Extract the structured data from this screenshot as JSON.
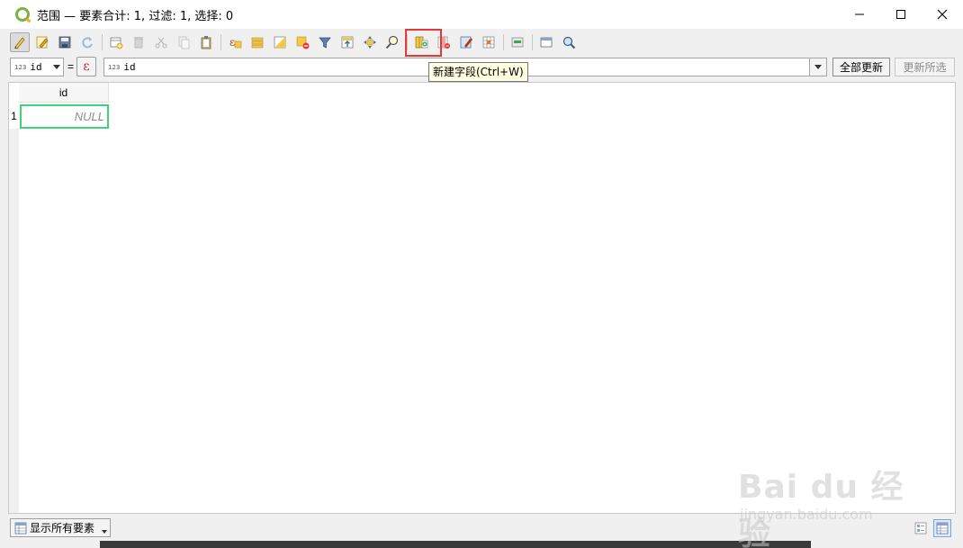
{
  "window": {
    "title": "范围 — 要素合计: 1, 过滤: 1, 选择: 0",
    "controls": [
      "minimize-icon",
      "maximize-icon",
      "close-icon"
    ]
  },
  "toolbar": {
    "buttons": [
      {
        "name": "toggle-editing-icon",
        "active": true
      },
      {
        "name": "multi-edit-icon"
      },
      {
        "name": "save-edits-icon"
      },
      {
        "name": "reload-icon"
      },
      {
        "name": "add-feature-icon"
      },
      {
        "name": "delete-feature-icon"
      },
      {
        "name": "cut-icon"
      },
      {
        "name": "copy-icon"
      },
      {
        "name": "paste-icon"
      },
      {
        "name": "select-by-expression-icon"
      },
      {
        "name": "select-all-icon"
      },
      {
        "name": "invert-selection-icon"
      },
      {
        "name": "deselect-icon"
      },
      {
        "name": "filter-icon"
      },
      {
        "name": "move-selection-top-icon"
      },
      {
        "name": "pan-to-selection-icon"
      },
      {
        "name": "zoom-to-selection-icon"
      },
      {
        "name": "new-field-icon"
      },
      {
        "name": "delete-field-icon"
      },
      {
        "name": "field-calculator-icon"
      },
      {
        "name": "conditional-formatting-icon"
      },
      {
        "name": "actions-icon"
      },
      {
        "name": "dock-icon"
      },
      {
        "name": "zoom-map-icon"
      }
    ],
    "tooltip": "新建字段(Ctrl+W)"
  },
  "calc_bar": {
    "field_type": "123",
    "field_value": "id",
    "equals": "=",
    "expression_symbol": "ε",
    "expression_type": "123",
    "expression_value": "id",
    "update_all_label": "全部更新",
    "update_selected_label": "更新所选"
  },
  "table": {
    "columns": [
      "id"
    ],
    "rows": [
      {
        "row_number": "1",
        "values": [
          "NULL"
        ]
      }
    ]
  },
  "status_bar": {
    "filter_label": "显示所有要素"
  },
  "watermark": {
    "brand": "Bai du 经验",
    "url": "jingyan.baidu.com"
  },
  "colors": {
    "highlight": "#e53935",
    "selected_cell_border": "#3fd37a",
    "tooltip_bg": "#ffffe1"
  }
}
